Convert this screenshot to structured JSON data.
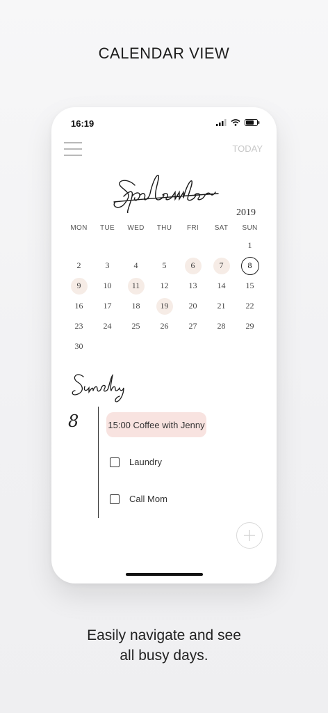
{
  "heading": "CALENDAR VIEW",
  "caption_line1": "Easily navigate and see",
  "caption_line2": "all busy days.",
  "status_bar": {
    "time": "16:19"
  },
  "header": {
    "today_label": "TODAY"
  },
  "calendar": {
    "month": "September",
    "year": "2019",
    "weekdays": [
      "MON",
      "TUE",
      "WED",
      "THU",
      "FRI",
      "SAT",
      "SUN"
    ],
    "weeks": [
      [
        "",
        "",
        "",
        "",
        "",
        "",
        "1"
      ],
      [
        "2",
        "3",
        "4",
        "5",
        "6",
        "7",
        "8"
      ],
      [
        "9",
        "10",
        "11",
        "12",
        "13",
        "14",
        "15"
      ],
      [
        "16",
        "17",
        "18",
        "19",
        "20",
        "21",
        "22"
      ],
      [
        "23",
        "24",
        "25",
        "26",
        "27",
        "28",
        "29"
      ],
      [
        "30",
        "",
        "",
        "",
        "",
        "",
        ""
      ]
    ],
    "busy_days": [
      "6",
      "7",
      "9",
      "11",
      "19"
    ],
    "selected_day": "8"
  },
  "agenda": {
    "weekday": "Sunday",
    "date": "8",
    "event": "15:00 Coffee with Jenny",
    "tasks": [
      "Laundry",
      "Call Mom"
    ]
  },
  "colors": {
    "busy": "#f6ece6",
    "event_bg": "#f8e3e0",
    "accent": "#222222"
  }
}
